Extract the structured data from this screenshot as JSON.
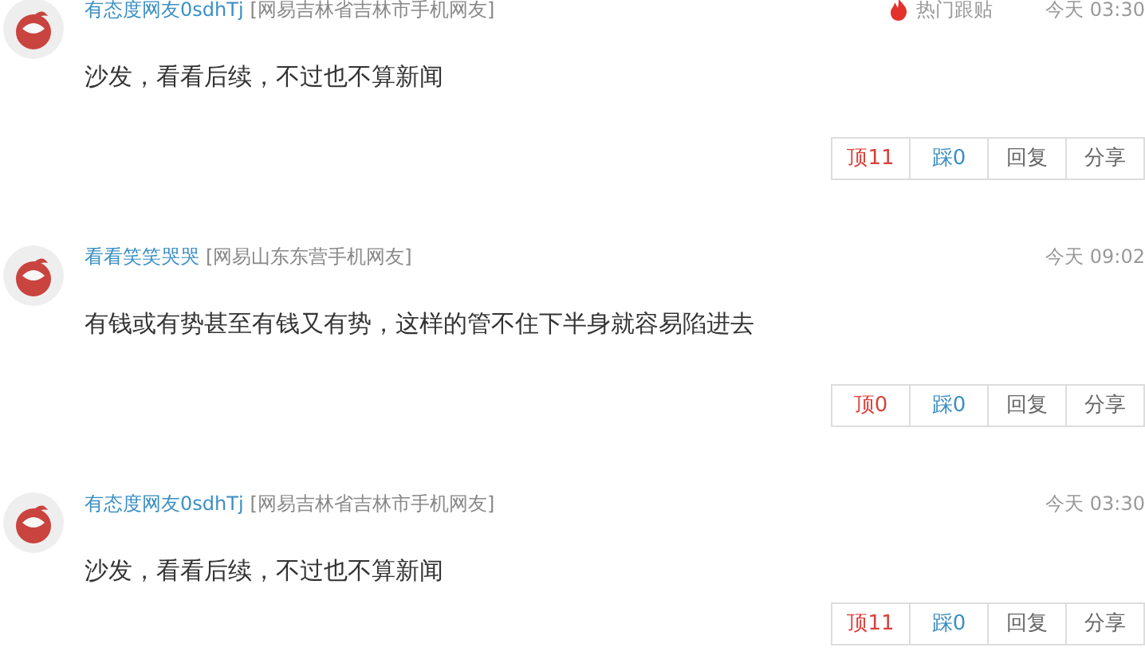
{
  "comments": [
    {
      "user": "有态度网友0sdhTj",
      "location": "[网易吉林省吉林市手机网友]",
      "badge": "热门跟贴",
      "time": "今天 03:30",
      "text": "沙发，看看后续，不过也不算新闻",
      "actions": [
        {
          "kind": "up",
          "label": "顶11"
        },
        {
          "kind": "down",
          "label": "踩0"
        },
        {
          "kind": "plain",
          "label": "回复"
        },
        {
          "kind": "plain",
          "label": "分享"
        }
      ]
    },
    {
      "user": "看看笑笑哭哭",
      "location": "[网易山东东营手机网友]",
      "time": "今天 09:02",
      "text": "有钱或有势甚至有钱又有势，这样的管不住下半身就容易陷进去",
      "actions": [
        {
          "kind": "up",
          "label": "顶0"
        },
        {
          "kind": "down",
          "label": "踩0"
        },
        {
          "kind": "plain",
          "label": "回复"
        },
        {
          "kind": "plain",
          "label": "分享"
        }
      ]
    },
    {
      "user": "有态度网友0sdhTj",
      "location": "[网易吉林省吉林市手机网友]",
      "time": "今天 03:30",
      "text": "沙发，看看后续，不过也不算新闻",
      "actions": [
        {
          "kind": "up",
          "label": "顶11"
        },
        {
          "kind": "down",
          "label": "踩0"
        },
        {
          "kind": "plain",
          "label": "回复"
        },
        {
          "kind": "plain",
          "label": "分享"
        }
      ]
    }
  ]
}
